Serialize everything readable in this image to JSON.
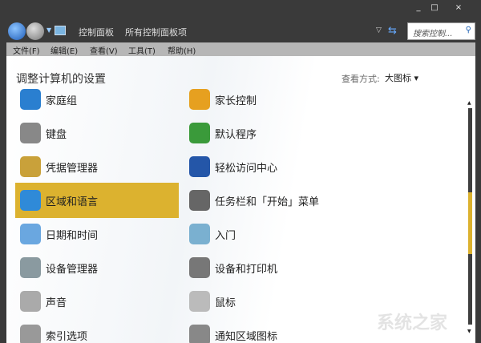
{
  "window": {
    "minimize": "_",
    "maximize": "□",
    "close": "×"
  },
  "breadcrumb": [
    "控制面板",
    "所有控制面板项"
  ],
  "search": {
    "placeholder": "搜索控制..."
  },
  "menu": [
    "文件(F)",
    "编辑(E)",
    "查看(V)",
    "工具(T)",
    "帮助(H)"
  ],
  "page_title": "调整计算机的设置",
  "view": {
    "label": "查看方式:",
    "value": "大图标 ▾"
  },
  "items_left": [
    {
      "label": "家庭组",
      "color": "#2a7fd0"
    },
    {
      "label": "键盘",
      "color": "#888"
    },
    {
      "label": "凭据管理器",
      "color": "#c9a13a"
    },
    {
      "label": "区域和语言",
      "color": "#2f8ad8",
      "selected": true
    },
    {
      "label": "日期和时间",
      "color": "#6aa7e0"
    },
    {
      "label": "设备管理器",
      "color": "#8a9aa0"
    },
    {
      "label": "声音",
      "color": "#aaa"
    },
    {
      "label": "索引选项",
      "color": "#999"
    }
  ],
  "items_right": [
    {
      "label": "家长控制",
      "color": "#e6a020"
    },
    {
      "label": "默认程序",
      "color": "#3a9a3a"
    },
    {
      "label": "轻松访问中心",
      "color": "#2456a8"
    },
    {
      "label": "任务栏和「开始」菜单",
      "color": "#666"
    },
    {
      "label": "入门",
      "color": "#7ab0d0"
    },
    {
      "label": "设备和打印机",
      "color": "#777"
    },
    {
      "label": "鼠标",
      "color": "#bbb"
    },
    {
      "label": "通知区域图标",
      "color": "#888"
    }
  ],
  "scroll": {
    "position_fraction": 0.45
  },
  "watermark": "系统之家"
}
